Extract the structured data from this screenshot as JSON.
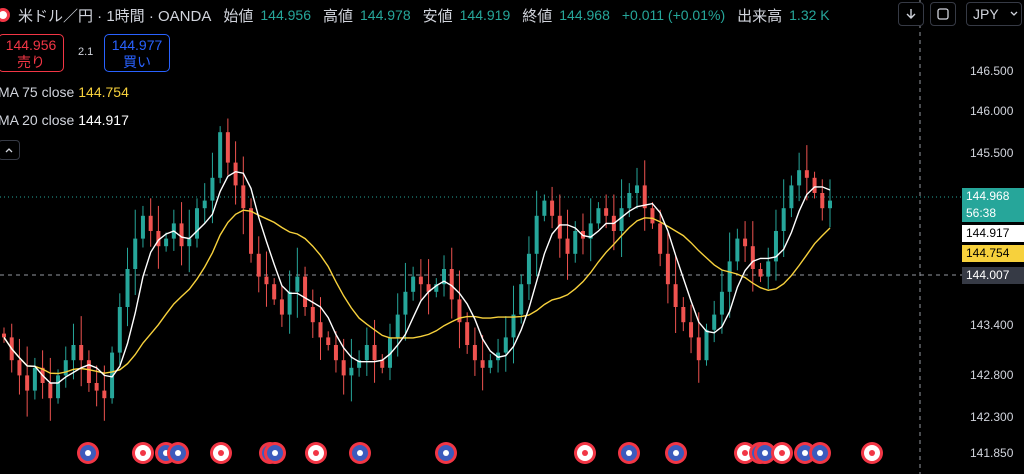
{
  "header": {
    "title": "米ドル／円 · 1時間 · OANDA",
    "open_label": "始値",
    "open_value": "144.956",
    "high_label": "高値",
    "high_value": "144.978",
    "low_label": "安値",
    "low_value": "144.919",
    "close_label": "終値",
    "close_value": "144.968",
    "change": "+0.011 (+0.01%)",
    "volume_label": "出来高",
    "volume_value": "1.32 K"
  },
  "toolbar": {
    "currency": "JPY",
    "currency_icon": "chevron-down-icon",
    "download_icon": "arrow-down-icon",
    "fullscreen_icon": "maximize-icon"
  },
  "trade": {
    "sell_price": "144.956",
    "sell_label": "売り",
    "spread": "2.1",
    "buy_price": "144.977",
    "buy_label": "買い"
  },
  "indicators": {
    "ma75_label": "MA 75 close",
    "ma75_value": "144.754",
    "ma20_label": "MA 20 close",
    "ma20_value": "144.917",
    "collapse_icon": "chevron-up-icon"
  },
  "price_axis": {
    "ticks": [
      "146.500",
      "146.000",
      "145.500",
      "143.400",
      "142.800",
      "142.300",
      "141.850"
    ]
  },
  "price_tags": {
    "last_price": "144.968",
    "countdown": "56:38",
    "ma20": "144.917",
    "ma75": "144.754",
    "crosshair": "144.007"
  },
  "colors": {
    "up": "#26a69a",
    "down": "#ef5350",
    "ma20": "#ffffff",
    "ma75": "#f7d13c",
    "background": "#000000"
  },
  "events": {
    "count": 20
  },
  "chart_data": {
    "type": "candlestick",
    "symbol": "USD/JPY",
    "interval": "1時間",
    "ylim": [
      141.85,
      146.8
    ],
    "close": [
      143.2,
      142.9,
      142.7,
      142.5,
      142.8,
      142.6,
      142.4,
      142.7,
      142.9,
      143.1,
      142.9,
      142.6,
      142.5,
      142.4,
      143.0,
      143.6,
      144.1,
      144.5,
      144.8,
      144.6,
      144.4,
      144.5,
      144.7,
      144.4,
      144.5,
      144.9,
      145.0,
      145.3,
      145.9,
      145.5,
      145.2,
      144.9,
      144.3,
      144.0,
      143.9,
      143.7,
      143.5,
      143.8,
      144.0,
      143.6,
      143.4,
      143.2,
      143.1,
      142.9,
      142.7,
      142.8,
      142.9,
      143.1,
      142.9,
      142.8,
      143.2,
      143.5,
      143.8,
      144.0,
      143.9,
      143.8,
      143.9,
      144.1,
      143.7,
      143.4,
      143.1,
      142.9,
      142.8,
      142.9,
      143.0,
      143.2,
      143.5,
      143.9,
      144.3,
      144.8,
      145.0,
      144.8,
      144.5,
      144.3,
      144.6,
      144.5,
      144.7,
      144.9,
      144.8,
      144.6,
      144.9,
      145.1,
      145.2,
      144.9,
      144.7,
      144.3,
      143.9,
      143.6,
      143.4,
      143.2,
      142.9,
      143.3,
      143.5,
      143.8,
      144.2,
      144.5,
      144.4,
      144.1,
      144.0,
      144.2,
      144.6,
      144.9,
      145.2,
      145.4,
      145.3,
      145.1,
      144.9,
      145.0
    ]
  }
}
